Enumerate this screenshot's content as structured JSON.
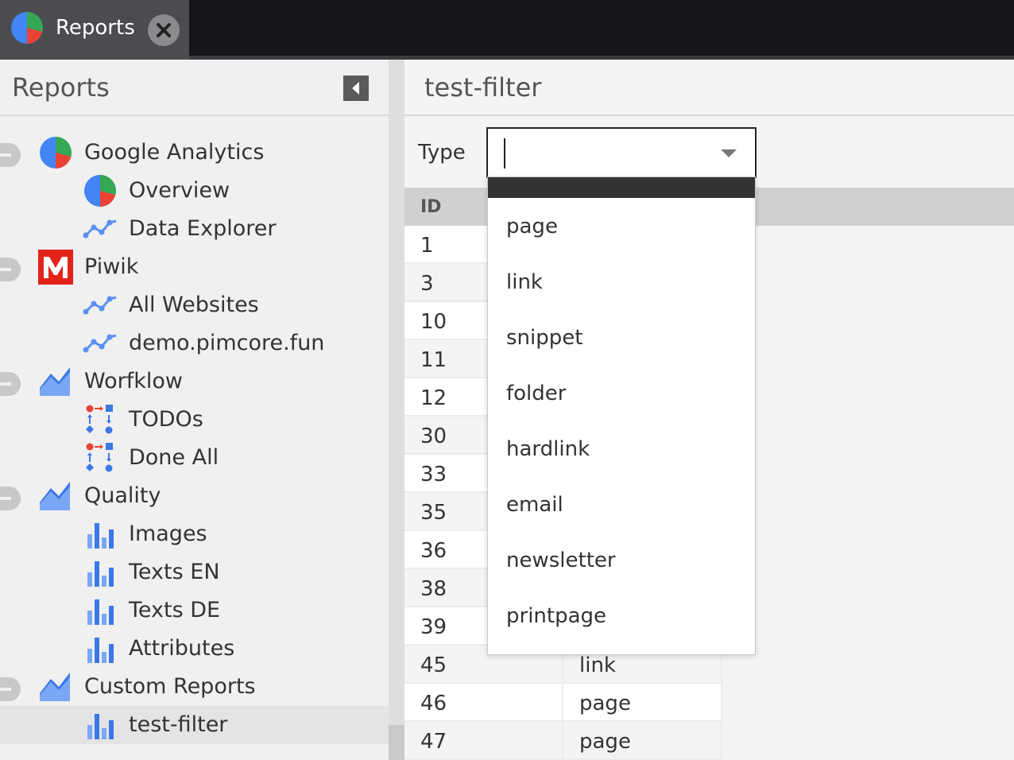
{
  "tab": {
    "label": "Reports"
  },
  "left_panel": {
    "title": "Reports",
    "tree": [
      {
        "label": "Google Analytics",
        "icon": "pie-chart-icon",
        "level": 0,
        "expanded": true
      },
      {
        "label": "Overview",
        "icon": "pie-chart-icon",
        "level": 1
      },
      {
        "label": "Data Explorer",
        "icon": "line-chart-icon",
        "level": 1
      },
      {
        "label": "Piwik",
        "icon": "piwik-logo-icon",
        "level": 0,
        "expanded": true
      },
      {
        "label": "All Websites",
        "icon": "line-chart-icon",
        "level": 1
      },
      {
        "label": "demo.pimcore.fun",
        "icon": "line-chart-icon",
        "level": 1
      },
      {
        "label": "Worfklow",
        "icon": "area-chart-icon",
        "level": 0,
        "expanded": true
      },
      {
        "label": "TODOs",
        "icon": "workflow-icon",
        "level": 1
      },
      {
        "label": "Done All",
        "icon": "workflow-icon",
        "level": 1
      },
      {
        "label": "Quality",
        "icon": "area-chart-icon",
        "level": 0,
        "expanded": true
      },
      {
        "label": "Images",
        "icon": "bar-chart-icon",
        "level": 1
      },
      {
        "label": "Texts EN",
        "icon": "bar-chart-icon",
        "level": 1
      },
      {
        "label": "Texts DE",
        "icon": "bar-chart-icon",
        "level": 1
      },
      {
        "label": "Attributes",
        "icon": "bar-chart-icon",
        "level": 1
      },
      {
        "label": "Custom Reports",
        "icon": "area-chart-icon",
        "level": 0,
        "expanded": true
      },
      {
        "label": "test-filter",
        "icon": "bar-chart-icon",
        "level": 1,
        "selected": true
      }
    ]
  },
  "right_panel": {
    "title": "test-filter",
    "filter_label": "Type",
    "filter_value": "",
    "grid": {
      "columns": [
        "ID"
      ],
      "rows": [
        {
          "id": "1",
          "type": ""
        },
        {
          "id": "3",
          "type": ""
        },
        {
          "id": "10",
          "type": ""
        },
        {
          "id": "11",
          "type": ""
        },
        {
          "id": "12",
          "type": ""
        },
        {
          "id": "30",
          "type": ""
        },
        {
          "id": "33",
          "type": ""
        },
        {
          "id": "35",
          "type": ""
        },
        {
          "id": "36",
          "type": ""
        },
        {
          "id": "38",
          "type": ""
        },
        {
          "id": "39",
          "type": ""
        },
        {
          "id": "45",
          "type": "link"
        },
        {
          "id": "46",
          "type": "page"
        },
        {
          "id": "47",
          "type": "page"
        }
      ]
    },
    "dropdown_options": [
      "",
      "page",
      "link",
      "snippet",
      "folder",
      "hardlink",
      "email",
      "newsletter",
      "printpage"
    ]
  },
  "colors": {
    "accent_blue": "#4285f4",
    "piwik_red": "#e2231a",
    "selected_row": "#e4e4e6"
  }
}
